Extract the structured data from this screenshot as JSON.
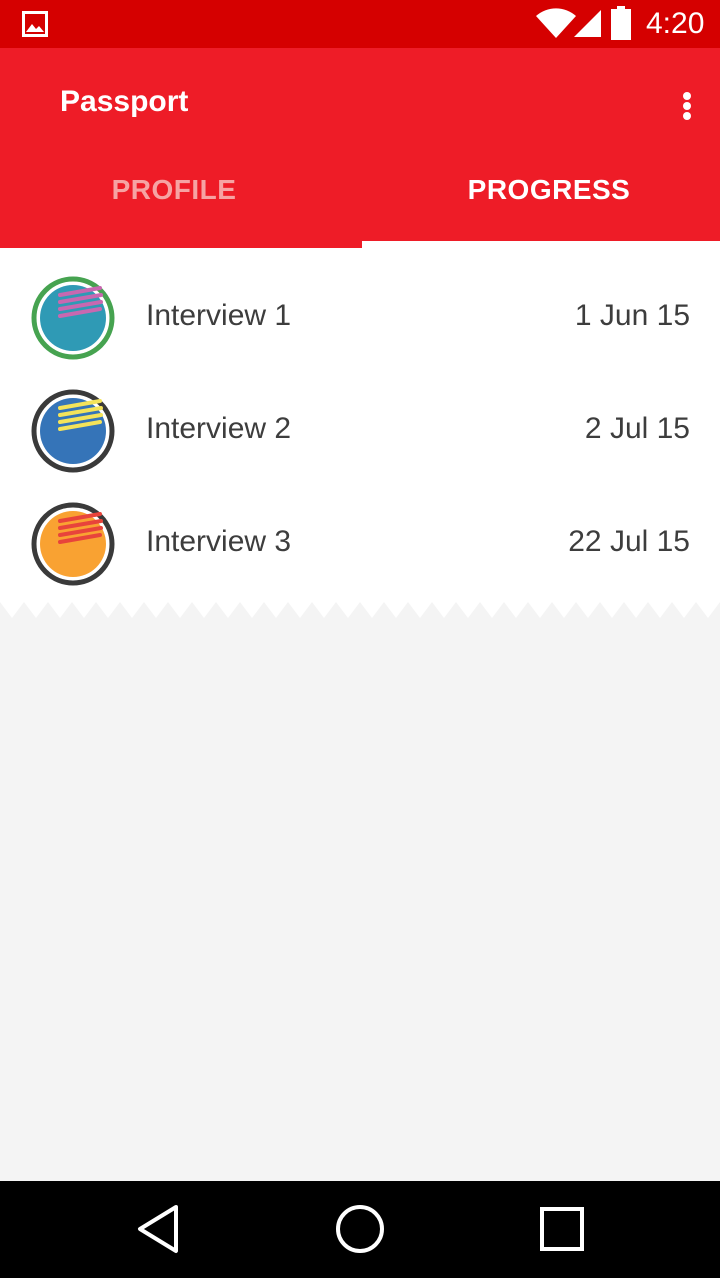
{
  "status_bar": {
    "time": "4:20",
    "icons": [
      "gallery-icon",
      "wifi-icon",
      "signal-icon",
      "battery-icon"
    ]
  },
  "app_bar": {
    "title": "Passport",
    "menu_icon": "overflow-menu-icon",
    "color": "#ee1c27"
  },
  "tabs": [
    {
      "label": "PROFILE",
      "selected": false
    },
    {
      "label": "PROGRESS",
      "selected": true
    }
  ],
  "interviews": [
    {
      "title": "Interview 1",
      "date": "1 Jun 15",
      "icon": "interview-badge-icon",
      "ring_color": "#46a350",
      "fill_color": "#2f9ab5",
      "stripe_color": "#c868b0"
    },
    {
      "title": "Interview 2",
      "date": "2 Jul 15",
      "icon": "interview-badge-icon",
      "ring_color": "#3a3a3a",
      "fill_color": "#3574b8",
      "stripe_color": "#f4e35a"
    },
    {
      "title": "Interview 3",
      "date": "22 Jul 15",
      "icon": "interview-badge-icon",
      "ring_color": "#3a3a3a",
      "fill_color": "#f9a232",
      "stripe_color": "#e8443b"
    }
  ],
  "nav_bar": {
    "icons": [
      "back-icon",
      "home-icon",
      "recents-icon"
    ]
  }
}
